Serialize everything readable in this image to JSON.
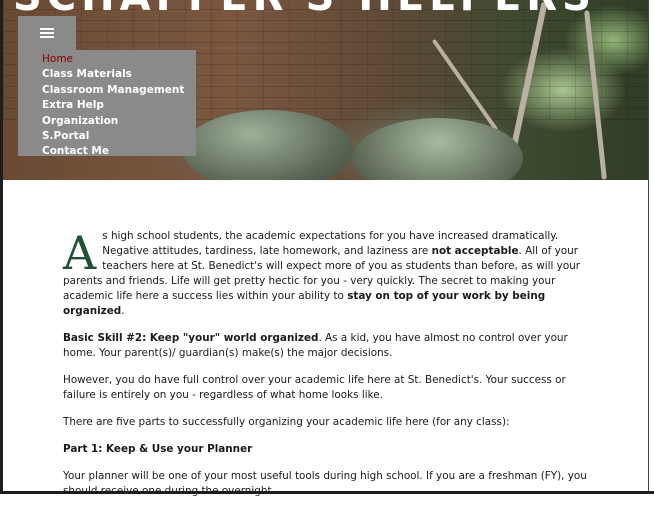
{
  "hero": {
    "title": "Schaffer's Helpers"
  },
  "menu": {
    "items": [
      {
        "label": "Home",
        "active": true
      },
      {
        "label": "Class Materials",
        "active": false
      },
      {
        "label": "Classroom Management",
        "active": false
      },
      {
        "label": "Extra Help",
        "active": false
      },
      {
        "label": "Organization",
        "active": false
      },
      {
        "label": "S.Portal",
        "active": false
      },
      {
        "label": "Contact Me",
        "active": false
      }
    ],
    "toggle_icon": "hamburger-icon",
    "active_color": "#8b0000",
    "background_color": "#8a8a8a"
  },
  "content": {
    "dropcap": "A",
    "dropcap_color": "#1f5135",
    "intro_a": "s high school students, the academic expectations for you have increased dramatically. Negative attitudes, tardiness, late homework, and laziness are ",
    "intro_b": "not acceptable",
    "intro_c": ". All of your teachers here at St. Benedict's will expect more of you as students than before, as will your parents and friends. Life will get pretty hectic for you - very quickly. The secret to making your academic life here a success lies within your ability to ",
    "intro_d": "stay on top of your work by being organized",
    "intro_e": ".",
    "skill_heading": "Basic Skill #2: Keep \"your\" world organized",
    "skill_text": ". As a kid, you have almost no control over your home. Your parent(s)/ guardian(s) make(s) the major decisions.",
    "control_text": "However, you do have full control over your academic life here at St. Benedict's. Your success or failure is entirely on you - regardless of what home looks like.",
    "five_parts_text": "There are five parts to successfully organizing your academic life here (for any class):",
    "part1_heading": "Part 1: Keep & Use your Planner",
    "planner_text": "Your planner will be one of your most useful tools during high school. If you are a freshman (FY), you should receive one during the overnight."
  }
}
